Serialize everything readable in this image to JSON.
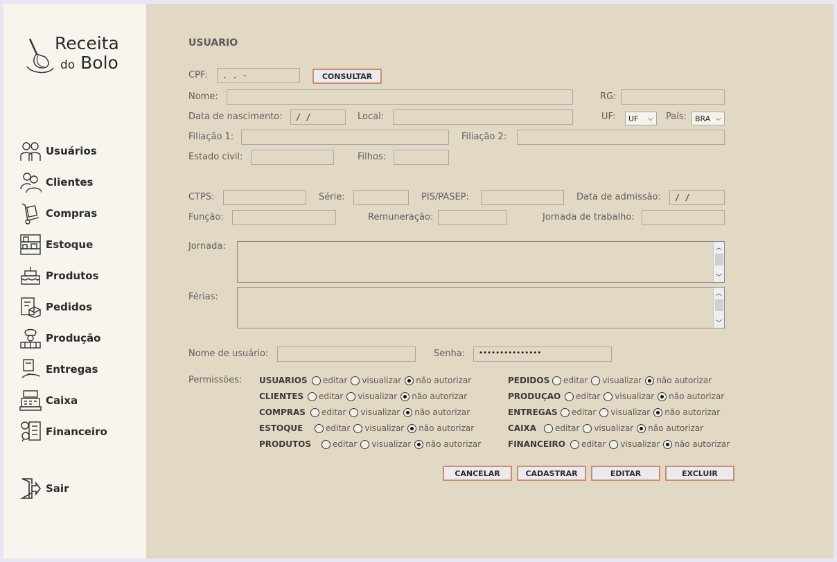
{
  "brand": {
    "line1": "Receita",
    "line2_small": "do",
    "line2": "Bolo"
  },
  "nav": [
    {
      "label": "Usuários",
      "icon": "users-icon"
    },
    {
      "label": "Clientes",
      "icon": "clients-icon"
    },
    {
      "label": "Compras",
      "icon": "hand-truck-icon"
    },
    {
      "label": "Estoque",
      "icon": "shelf-icon"
    },
    {
      "label": "Produtos",
      "icon": "cake-icon"
    },
    {
      "label": "Pedidos",
      "icon": "order-box-icon"
    },
    {
      "label": "Produção",
      "icon": "chef-icon"
    },
    {
      "label": "Entregas",
      "icon": "delivery-icon"
    },
    {
      "label": "Caixa",
      "icon": "cash-register-icon"
    },
    {
      "label": "Financeiro",
      "icon": "finance-icon"
    },
    {
      "label": "Sair",
      "icon": "exit-door-icon"
    }
  ],
  "form": {
    "title": "USUARIO",
    "cpf_label": "CPF:",
    "cpf_value": " .  .  -",
    "consultar": "CONSULTAR",
    "nome_label": "Nome:",
    "rg_label": "RG:",
    "nasc_label": "Data de nascimento:",
    "nasc_value": "/ /",
    "local_label": "Local:",
    "uf_label": "UF:",
    "uf_value": "UF",
    "pais_label": "País:",
    "pais_value": "BRA",
    "fil1_label": "Filiação 1:",
    "fil2_label": "Filiação 2:",
    "estado_label": "Estado civil:",
    "filhos_label": "Filhos:",
    "ctps_label": "CTPS:",
    "serie_label": "Série:",
    "pis_label": "PIS/PASEP:",
    "admissao_label": "Data de admissão:",
    "admissao_value": "/ /",
    "funcao_label": "Função:",
    "remun_label": "Remuneração:",
    "jornadat_label": "Jornada de trabalho:",
    "jornada_label": "Jornada:",
    "ferias_label": "Férias:",
    "usuario_label": "Nome de usuário:",
    "senha_label": "Senha:",
    "senha_value": "•••••••••••••••",
    "permissoes_label": "Permissões:"
  },
  "permissions": {
    "options": [
      "editar",
      "visualizar",
      "não autorizar"
    ],
    "left": [
      {
        "module": "USUARIOS",
        "selected": 2
      },
      {
        "module": "CLIENTES",
        "selected": 2
      },
      {
        "module": "COMPRAS",
        "selected": 2
      },
      {
        "module": "ESTOQUE",
        "selected": 2
      },
      {
        "module": "PRODUTOS",
        "selected": 2
      }
    ],
    "right": [
      {
        "module": "PEDIDOS",
        "selected": 2
      },
      {
        "module": "PRODUÇAO",
        "selected": 2
      },
      {
        "module": "ENTREGAS",
        "selected": 2
      },
      {
        "module": "CAIXA",
        "selected": 2
      },
      {
        "module": "FINANCEIRO",
        "selected": 2
      }
    ]
  },
  "actions": {
    "cancelar": "CANCELAR",
    "cadastrar": "CADASTRAR",
    "editar": "EDITAR",
    "excluir": "EXCLUIR"
  }
}
